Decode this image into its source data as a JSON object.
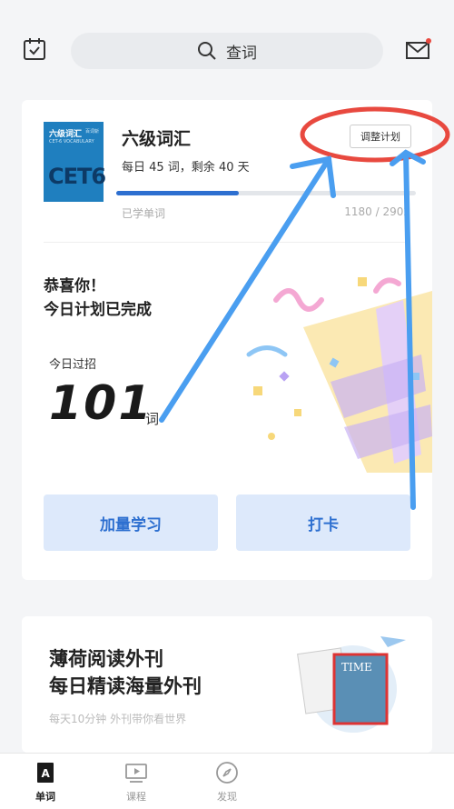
{
  "search": {
    "label": "查词"
  },
  "book": {
    "cover_title": "六级词汇",
    "cover_subtitle": "CET-6 VOCABULARY",
    "cover_brand": "百词斩",
    "cover_big": "CET6",
    "title": "六级词汇",
    "plan_text": "每日 45 词，剩余 40 天",
    "adjust_label": "调整计划",
    "learned_label": "已学单词",
    "learned_count": "1180 / 2902",
    "progress": 0.41
  },
  "today": {
    "congrats_line1": "恭喜你！",
    "congrats_line2": "今日计划已完成",
    "label": "今日过招",
    "count": "101",
    "unit": "词"
  },
  "actions": {
    "more_label": "加量学习",
    "checkin_label": "打卡"
  },
  "promo": {
    "line1": "薄荷阅读外刊",
    "line2": "每日精读海量外刊",
    "subtitle": "每天10分钟 外刊带你看世界",
    "mag_title": "TIME"
  },
  "tabs": [
    {
      "label": "单词",
      "active": true
    },
    {
      "label": "课程",
      "active": false
    },
    {
      "label": "发现",
      "active": false
    }
  ],
  "colors": {
    "accent": "#2d6fd0",
    "annotation_blue": "#4a9ef0",
    "annotation_red": "#e8493f"
  }
}
